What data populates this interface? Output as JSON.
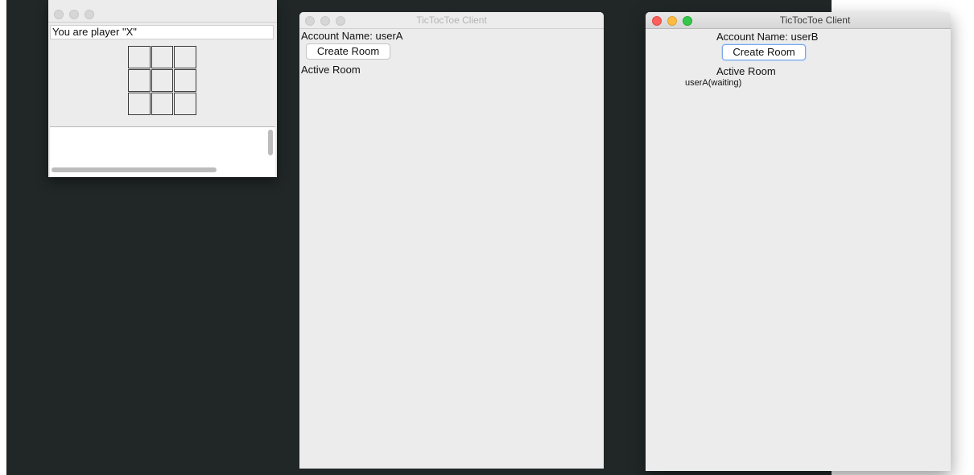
{
  "game_window": {
    "status": "You are player \"X\"",
    "board": [
      "",
      "",
      "",
      "",
      "",
      "",
      "",
      "",
      ""
    ]
  },
  "client_a": {
    "title": "TicTocToe Client",
    "account_label": "Account Name: userA",
    "create_room_label": "Create Room",
    "active_room_label": "Active Room",
    "rooms": []
  },
  "client_b": {
    "title": "TicTocToe Client",
    "account_label": "Account Name: userB",
    "create_room_label": "Create Room",
    "active_room_label": "Active Room",
    "rooms": [
      "userA(waiting)"
    ]
  },
  "colors": {
    "desktop": "#212727",
    "window_bg": "#ececec",
    "close": "#fc605c",
    "minimize": "#fdbc40",
    "zoom": "#34c84a"
  }
}
